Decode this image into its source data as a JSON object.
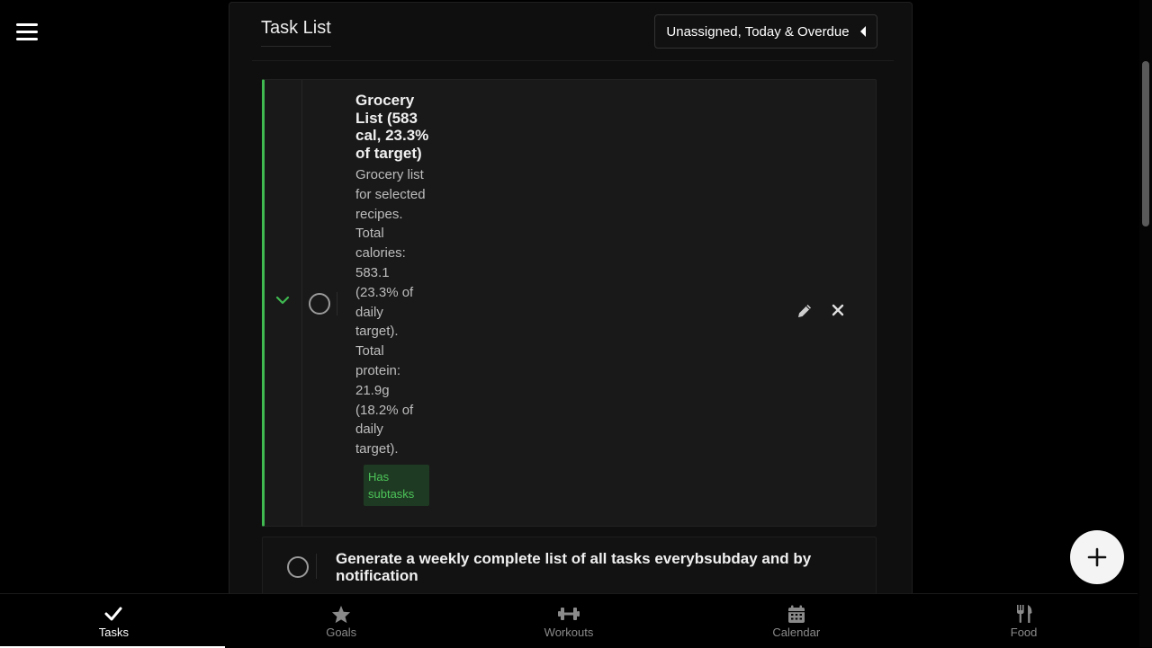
{
  "header": {
    "title": "Task List",
    "filter_label": "Unassigned, Today & Overdue"
  },
  "tasks": [
    {
      "title": "Grocery List (583 cal, 23.3% of target)",
      "description": "Grocery list for selected recipes. Total calories: 583.1 (23.3% of daily target). Total protein: 21.9g (18.2% of daily target).",
      "badge": "Has subtasks"
    },
    {
      "title": "Generate a weekly complete list of all tasks everybsubday and by notification"
    }
  ],
  "nav": {
    "items": [
      {
        "label": "Tasks",
        "icon": "check-icon"
      },
      {
        "label": "Goals",
        "icon": "star-icon"
      },
      {
        "label": "Workouts",
        "icon": "dumbbell-icon"
      },
      {
        "label": "Calendar",
        "icon": "calendar-icon"
      },
      {
        "label": "Food",
        "icon": "utensils-icon"
      }
    ],
    "active": "Tasks"
  },
  "colors": {
    "accent": "#3fb950",
    "badge_bg": "#1f3a22",
    "badge_text": "#4cc55a",
    "background": "#000000"
  }
}
